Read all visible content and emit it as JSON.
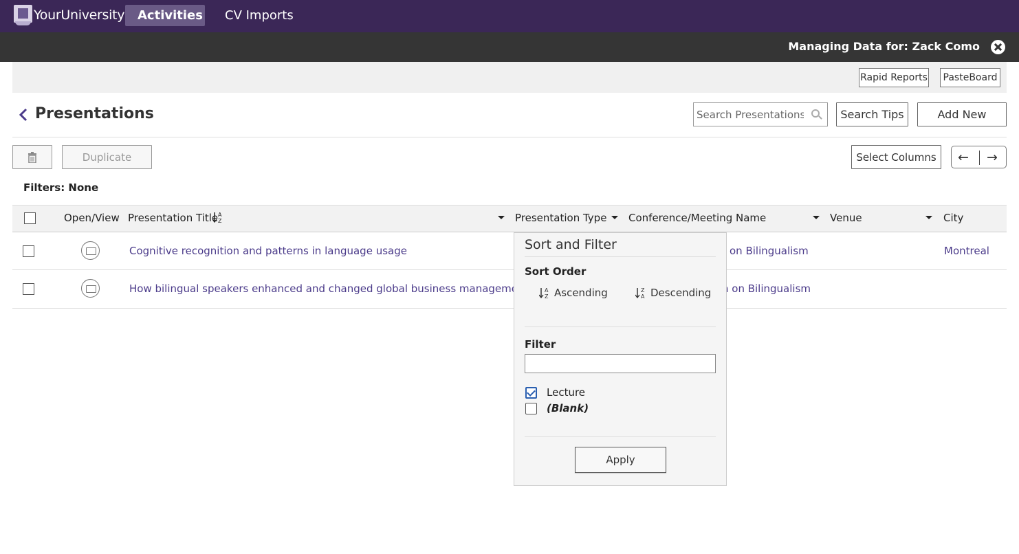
{
  "topnav": {
    "logo_text": "YourUniversity",
    "items": [
      {
        "label": "Activities",
        "active": true
      },
      {
        "label": "CV Imports",
        "active": false
      }
    ]
  },
  "managebar": {
    "label": "Managing Data for: Zack Como"
  },
  "utilbar": {
    "rapid_reports": "Rapid Reports",
    "pasteboard": "PasteBoard"
  },
  "header": {
    "title": "Presentations",
    "search_placeholder": "Search Presentations",
    "search_tips": "Search Tips",
    "add_new": "Add New"
  },
  "toolbar": {
    "duplicate": "Duplicate",
    "select_columns": "Select Columns",
    "prev_arrow": "←",
    "next_arrow": "→"
  },
  "filters": "Filters: None",
  "table": {
    "columns": [
      "Open/View",
      "Presentation Title",
      "Presentation Type",
      "Conference/Meeting Name",
      "Venue",
      "City"
    ],
    "rows": [
      {
        "title": "Cognitive recognition and patterns in language usage",
        "conference": "on Bilingualism",
        "city": "Montreal"
      },
      {
        "title": "How bilingual speakers enhanced and changed global business management",
        "conference": "n on Bilingualism",
        "city": ""
      }
    ]
  },
  "sort_filter_popup": {
    "title": "Sort and Filter",
    "sort_order_label": "Sort Order",
    "ascending": "Ascending",
    "descending": "Descending",
    "filter_label": "Filter",
    "filter_value": "",
    "options": [
      {
        "label": "Lecture",
        "checked": true
      },
      {
        "label": "(Blank)",
        "checked": false
      }
    ],
    "apply": "Apply"
  },
  "colors": {
    "nav_bg": "#3b2757",
    "nav_active": "#6a5a86",
    "link": "#4b3b8a",
    "manage_bg": "#353535"
  }
}
